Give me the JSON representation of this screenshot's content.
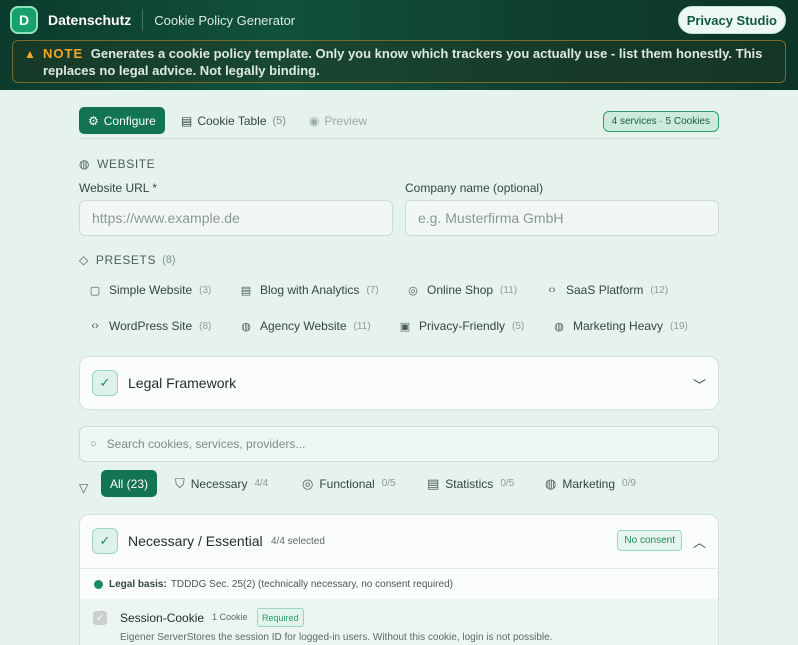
{
  "header": {
    "logo_letter": "D",
    "brand": "Datenschutz",
    "subtitle": "Cookie Policy Generator",
    "studio_button": "Privacy Studio"
  },
  "note": {
    "label": "NOTE",
    "text": "Generates a cookie policy template. Only you know which trackers you actually use - list them honestly. This replaces no legal advice. Not legally binding."
  },
  "tabs": [
    {
      "label": "Configure",
      "icon": "gear-icon"
    },
    {
      "label": "Cookie Table",
      "count": "(5)",
      "icon": "table-icon"
    },
    {
      "label": "Preview",
      "icon": "eye-icon"
    }
  ],
  "services_badge": "4 services · 5 Cookies",
  "website": {
    "section": "WEBSITE",
    "url_label": "Website URL *",
    "url_placeholder": "https://www.example.de",
    "company_label": "Company name (optional)",
    "company_placeholder": "e.g. Musterfirma GmbH"
  },
  "presets": {
    "section": "PRESETS",
    "count": "(8)",
    "items": [
      {
        "label": "Simple Website",
        "count": "(3)",
        "icon": "document-icon"
      },
      {
        "label": "Blog with Analytics",
        "count": "(7)",
        "icon": "table-icon"
      },
      {
        "label": "Online Shop",
        "count": "(11)",
        "icon": "cookie-icon"
      },
      {
        "label": "SaaS Platform",
        "count": "(12)",
        "icon": "code-icon"
      },
      {
        "label": "WordPress Site",
        "count": "(8)",
        "icon": "code-icon"
      },
      {
        "label": "Agency Website",
        "count": "(11)",
        "icon": "globe-icon"
      },
      {
        "label": "Privacy-Friendly",
        "count": "(5)",
        "icon": "lock-icon"
      },
      {
        "label": "Marketing Heavy",
        "count": "(19)",
        "icon": "globe-icon"
      }
    ]
  },
  "legal_framework": {
    "title": "Legal Framework"
  },
  "search": {
    "placeholder": "Search cookies, services, providers..."
  },
  "filters": [
    {
      "label": "All (23)"
    },
    {
      "label": "Necessary",
      "count": "4/4",
      "icon": "shield-icon"
    },
    {
      "label": "Functional",
      "count": "0/5",
      "icon": "cookie-icon"
    },
    {
      "label": "Statistics",
      "count": "0/5",
      "icon": "table-icon"
    },
    {
      "label": "Marketing",
      "count": "0/9",
      "icon": "globe-icon"
    }
  ],
  "necessary": {
    "title": "Necessary / Essential",
    "selected": "4/4 selected",
    "consent_badge": "No consent",
    "legal_basis_label": "Legal basis:",
    "legal_basis_text": "TDDDG Sec. 25(2) (technically necessary, no consent required)",
    "cookie": {
      "name": "Session-Cookie",
      "count": "1 Cookie",
      "badge": "Required",
      "desc": "Eigener ServerStores the session ID for logged-in users. Without this cookie, login is not possible."
    }
  },
  "colors": {
    "accent": "#127451",
    "header": "#0f4535",
    "warning": "#f4a62a"
  }
}
